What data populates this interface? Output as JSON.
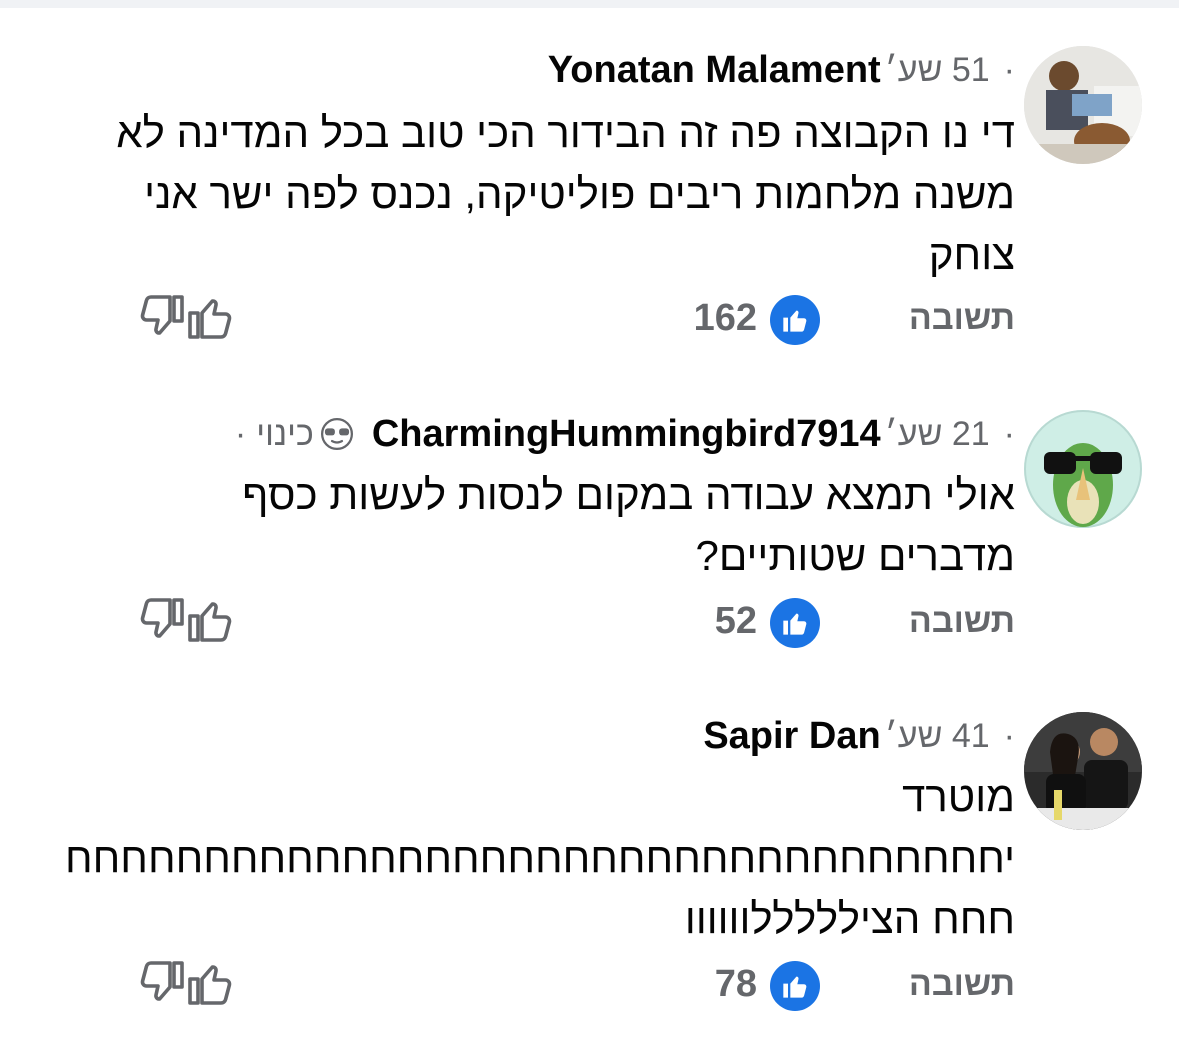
{
  "comments": [
    {
      "author": "Yonatan Malament",
      "time": "51 שע׳",
      "text": "די נו הקבוצה פה זה הבידור הכי טוב בכל המדינה לא\nמשנה מלחמות ריבים פוליטיקה, נכנס לפה ישר אני\nצוחק",
      "likes": "162",
      "reply": "תשובה",
      "avatar_icon": "photo-avatar"
    },
    {
      "author": "CharmingHummingbird7914",
      "time": "21 שע׳",
      "nickname": "כינוי",
      "nickname_icon": "sunglasses-icon",
      "text": "אולי תמצא עבודה במקום לנסות לעשות כסף\nמדברים שטותיים?",
      "likes": "52",
      "reply": "תשובה",
      "avatar_icon": "bird-sunglasses-avatar"
    },
    {
      "author": "Sapir Dan",
      "time": "41 שע׳",
      "text": "מוטרד\nיחחחחחחחחחחחחחחחחחחחחחחחחחחחחחחחחחח\nחחח הצילללללוווווו",
      "likes": "78",
      "reply": "תשובה",
      "avatar_icon": "photo-avatar"
    }
  ],
  "colors": {
    "accent": "#1b74e4",
    "secondary_text": "#65676b",
    "primary_text": "#050505"
  }
}
